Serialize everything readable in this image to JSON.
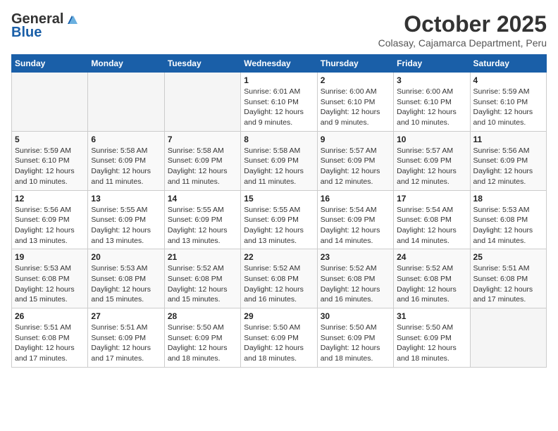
{
  "header": {
    "logo_general": "General",
    "logo_blue": "Blue",
    "month": "October 2025",
    "location": "Colasay, Cajamarca Department, Peru"
  },
  "days_of_week": [
    "Sunday",
    "Monday",
    "Tuesday",
    "Wednesday",
    "Thursday",
    "Friday",
    "Saturday"
  ],
  "weeks": [
    [
      {
        "day": "",
        "info": ""
      },
      {
        "day": "",
        "info": ""
      },
      {
        "day": "",
        "info": ""
      },
      {
        "day": "1",
        "info": "Sunrise: 6:01 AM\nSunset: 6:10 PM\nDaylight: 12 hours\nand 9 minutes."
      },
      {
        "day": "2",
        "info": "Sunrise: 6:00 AM\nSunset: 6:10 PM\nDaylight: 12 hours\nand 9 minutes."
      },
      {
        "day": "3",
        "info": "Sunrise: 6:00 AM\nSunset: 6:10 PM\nDaylight: 12 hours\nand 10 minutes."
      },
      {
        "day": "4",
        "info": "Sunrise: 5:59 AM\nSunset: 6:10 PM\nDaylight: 12 hours\nand 10 minutes."
      }
    ],
    [
      {
        "day": "5",
        "info": "Sunrise: 5:59 AM\nSunset: 6:10 PM\nDaylight: 12 hours\nand 10 minutes."
      },
      {
        "day": "6",
        "info": "Sunrise: 5:58 AM\nSunset: 6:09 PM\nDaylight: 12 hours\nand 11 minutes."
      },
      {
        "day": "7",
        "info": "Sunrise: 5:58 AM\nSunset: 6:09 PM\nDaylight: 12 hours\nand 11 minutes."
      },
      {
        "day": "8",
        "info": "Sunrise: 5:58 AM\nSunset: 6:09 PM\nDaylight: 12 hours\nand 11 minutes."
      },
      {
        "day": "9",
        "info": "Sunrise: 5:57 AM\nSunset: 6:09 PM\nDaylight: 12 hours\nand 12 minutes."
      },
      {
        "day": "10",
        "info": "Sunrise: 5:57 AM\nSunset: 6:09 PM\nDaylight: 12 hours\nand 12 minutes."
      },
      {
        "day": "11",
        "info": "Sunrise: 5:56 AM\nSunset: 6:09 PM\nDaylight: 12 hours\nand 12 minutes."
      }
    ],
    [
      {
        "day": "12",
        "info": "Sunrise: 5:56 AM\nSunset: 6:09 PM\nDaylight: 12 hours\nand 13 minutes."
      },
      {
        "day": "13",
        "info": "Sunrise: 5:55 AM\nSunset: 6:09 PM\nDaylight: 12 hours\nand 13 minutes."
      },
      {
        "day": "14",
        "info": "Sunrise: 5:55 AM\nSunset: 6:09 PM\nDaylight: 12 hours\nand 13 minutes."
      },
      {
        "day": "15",
        "info": "Sunrise: 5:55 AM\nSunset: 6:09 PM\nDaylight: 12 hours\nand 13 minutes."
      },
      {
        "day": "16",
        "info": "Sunrise: 5:54 AM\nSunset: 6:09 PM\nDaylight: 12 hours\nand 14 minutes."
      },
      {
        "day": "17",
        "info": "Sunrise: 5:54 AM\nSunset: 6:08 PM\nDaylight: 12 hours\nand 14 minutes."
      },
      {
        "day": "18",
        "info": "Sunrise: 5:53 AM\nSunset: 6:08 PM\nDaylight: 12 hours\nand 14 minutes."
      }
    ],
    [
      {
        "day": "19",
        "info": "Sunrise: 5:53 AM\nSunset: 6:08 PM\nDaylight: 12 hours\nand 15 minutes."
      },
      {
        "day": "20",
        "info": "Sunrise: 5:53 AM\nSunset: 6:08 PM\nDaylight: 12 hours\nand 15 minutes."
      },
      {
        "day": "21",
        "info": "Sunrise: 5:52 AM\nSunset: 6:08 PM\nDaylight: 12 hours\nand 15 minutes."
      },
      {
        "day": "22",
        "info": "Sunrise: 5:52 AM\nSunset: 6:08 PM\nDaylight: 12 hours\nand 16 minutes."
      },
      {
        "day": "23",
        "info": "Sunrise: 5:52 AM\nSunset: 6:08 PM\nDaylight: 12 hours\nand 16 minutes."
      },
      {
        "day": "24",
        "info": "Sunrise: 5:52 AM\nSunset: 6:08 PM\nDaylight: 12 hours\nand 16 minutes."
      },
      {
        "day": "25",
        "info": "Sunrise: 5:51 AM\nSunset: 6:08 PM\nDaylight: 12 hours\nand 17 minutes."
      }
    ],
    [
      {
        "day": "26",
        "info": "Sunrise: 5:51 AM\nSunset: 6:08 PM\nDaylight: 12 hours\nand 17 minutes."
      },
      {
        "day": "27",
        "info": "Sunrise: 5:51 AM\nSunset: 6:09 PM\nDaylight: 12 hours\nand 17 minutes."
      },
      {
        "day": "28",
        "info": "Sunrise: 5:50 AM\nSunset: 6:09 PM\nDaylight: 12 hours\nand 18 minutes."
      },
      {
        "day": "29",
        "info": "Sunrise: 5:50 AM\nSunset: 6:09 PM\nDaylight: 12 hours\nand 18 minutes."
      },
      {
        "day": "30",
        "info": "Sunrise: 5:50 AM\nSunset: 6:09 PM\nDaylight: 12 hours\nand 18 minutes."
      },
      {
        "day": "31",
        "info": "Sunrise: 5:50 AM\nSunset: 6:09 PM\nDaylight: 12 hours\nand 18 minutes."
      },
      {
        "day": "",
        "info": ""
      }
    ]
  ]
}
